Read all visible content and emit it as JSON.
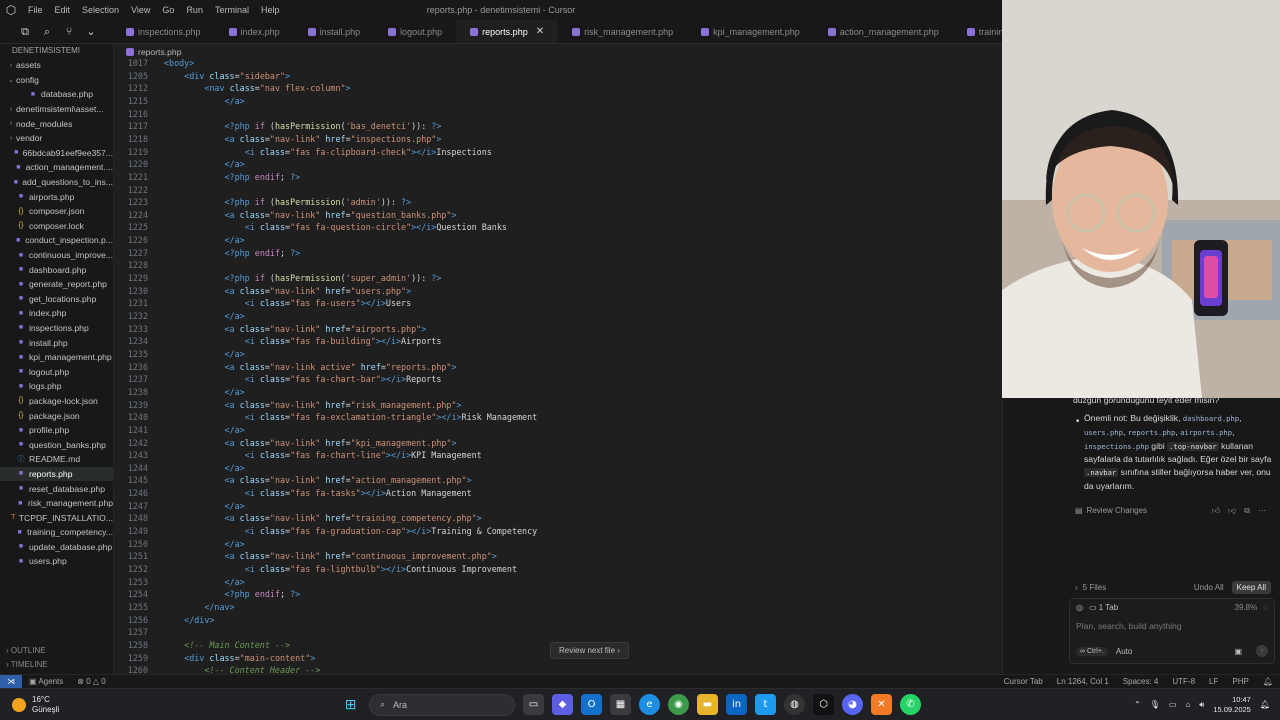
{
  "window": {
    "title": "reports.php - denetimsistemi - Cursor",
    "menu": [
      "File",
      "Edit",
      "Selection",
      "View",
      "Go",
      "Run",
      "Terminal",
      "Help"
    ]
  },
  "tabs": [
    {
      "label": "inspections.php",
      "active": false
    },
    {
      "label": "index.php",
      "active": false
    },
    {
      "label": "install.php",
      "active": false
    },
    {
      "label": "logout.php",
      "active": false
    },
    {
      "label": "reports.php",
      "active": true
    },
    {
      "label": "risk_management.php",
      "active": false
    },
    {
      "label": "kpi_management.php",
      "active": false
    },
    {
      "label": "action_management.php",
      "active": false
    },
    {
      "label": "training_compe",
      "active": false
    }
  ],
  "explorer": {
    "root": "DENETIMSISTEMI",
    "items": [
      {
        "label": "assets",
        "type": "folder",
        "indent": 1
      },
      {
        "label": "config",
        "type": "folder-open",
        "indent": 1
      },
      {
        "label": "database.php",
        "type": "php",
        "indent": 2
      },
      {
        "label": "denetimsistemi\\asset...",
        "type": "folder",
        "indent": 1
      },
      {
        "label": "node_modules",
        "type": "folder",
        "indent": 1
      },
      {
        "label": "vendor",
        "type": "folder",
        "indent": 1
      },
      {
        "label": "66bdcab91eef9ee357...",
        "type": "php",
        "indent": 1
      },
      {
        "label": "action_management....",
        "type": "php",
        "indent": 1
      },
      {
        "label": "add_questions_to_ins...",
        "type": "php",
        "indent": 1
      },
      {
        "label": "airports.php",
        "type": "php",
        "indent": 1
      },
      {
        "label": "composer.json",
        "type": "json",
        "indent": 1
      },
      {
        "label": "composer.lock",
        "type": "json",
        "indent": 1
      },
      {
        "label": "conduct_inspection.p...",
        "type": "php",
        "indent": 1
      },
      {
        "label": "continuous_improve...",
        "type": "php",
        "indent": 1
      },
      {
        "label": "dashboard.php",
        "type": "php",
        "indent": 1
      },
      {
        "label": "generate_report.php",
        "type": "php",
        "indent": 1
      },
      {
        "label": "get_locations.php",
        "type": "php",
        "indent": 1
      },
      {
        "label": "index.php",
        "type": "php",
        "indent": 1
      },
      {
        "label": "inspections.php",
        "type": "php",
        "indent": 1
      },
      {
        "label": "install.php",
        "type": "php",
        "indent": 1
      },
      {
        "label": "kpi_management.php",
        "type": "php",
        "indent": 1
      },
      {
        "label": "logout.php",
        "type": "php",
        "indent": 1
      },
      {
        "label": "logs.php",
        "type": "php",
        "indent": 1
      },
      {
        "label": "package-lock.json",
        "type": "json",
        "indent": 1
      },
      {
        "label": "package.json",
        "type": "json",
        "indent": 1
      },
      {
        "label": "profile.php",
        "type": "php",
        "indent": 1
      },
      {
        "label": "question_banks.php",
        "type": "php",
        "indent": 1
      },
      {
        "label": "README.md",
        "type": "md",
        "indent": 1
      },
      {
        "label": "reports.php",
        "type": "php",
        "indent": 1,
        "selected": true
      },
      {
        "label": "reset_database.php",
        "type": "php",
        "indent": 1
      },
      {
        "label": "risk_management.php",
        "type": "php",
        "indent": 1
      },
      {
        "label": "TCPDF_INSTALLATIO...",
        "type": "tex",
        "indent": 1
      },
      {
        "label": "training_competency...",
        "type": "php",
        "indent": 1
      },
      {
        "label": "update_database.php",
        "type": "php",
        "indent": 1
      },
      {
        "label": "users.php",
        "type": "php",
        "indent": 1
      }
    ],
    "outline": "OUTLINE",
    "timeline": "TIMELINE"
  },
  "editor": {
    "breadcrumb": "reports.php",
    "review_next": "Review next file",
    "lines": [
      {
        "n": "1017",
        "html": "<span class=\"tok-tag\">&lt;body&gt;</span>"
      },
      {
        "n": "1205",
        "html": "    <span class=\"tok-tag\">&lt;div</span> <span class=\"tok-attr\">class</span>=<span class=\"tok-str\">\"sidebar\"</span><span class=\"tok-tag\">&gt;</span>"
      },
      {
        "n": "1212",
        "html": "        <span class=\"tok-tag\">&lt;nav</span> <span class=\"tok-attr\">class</span>=<span class=\"tok-str\">\"nav flex-column\"</span><span class=\"tok-tag\">&gt;</span>"
      },
      {
        "n": "1215",
        "html": "            <span class=\"tok-tag\">&lt;/a&gt;</span>"
      },
      {
        "n": "1216",
        "html": ""
      },
      {
        "n": "1217",
        "html": "            <span class=\"tok-php\">&lt;?php</span> <span class=\"tok-kw\">if</span> (<span class=\"tok-fn\">hasPermission</span>(<span class=\"tok-str\">'bas_denetci'</span>)): <span class=\"tok-php\">?&gt;</span>"
      },
      {
        "n": "1218",
        "html": "            <span class=\"tok-tag\">&lt;a</span> <span class=\"tok-attr\">class</span>=<span class=\"tok-str\">\"nav-link\"</span> <span class=\"tok-attr\">href</span>=<span class=\"tok-str\">\"inspections.php\"</span><span class=\"tok-tag\">&gt;</span>"
      },
      {
        "n": "1219",
        "html": "                <span class=\"tok-tag\">&lt;i</span> <span class=\"tok-attr\">class</span>=<span class=\"tok-str\">\"fas fa-clipboard-check\"</span><span class=\"tok-tag\">&gt;&lt;/i&gt;</span>Inspections"
      },
      {
        "n": "1220",
        "html": "            <span class=\"tok-tag\">&lt;/a&gt;</span>"
      },
      {
        "n": "1221",
        "html": "            <span class=\"tok-php\">&lt;?php</span> <span class=\"tok-kw\">endif</span>; <span class=\"tok-php\">?&gt;</span>"
      },
      {
        "n": "1222",
        "html": ""
      },
      {
        "n": "1223",
        "html": "            <span class=\"tok-php\">&lt;?php</span> <span class=\"tok-kw\">if</span> (<span class=\"tok-fn\">hasPermission</span>(<span class=\"tok-str\">'admin'</span>)): <span class=\"tok-php\">?&gt;</span>"
      },
      {
        "n": "1224",
        "html": "            <span class=\"tok-tag\">&lt;a</span> <span class=\"tok-attr\">class</span>=<span class=\"tok-str\">\"nav-link\"</span> <span class=\"tok-attr\">href</span>=<span class=\"tok-str\">\"question_banks.php\"</span><span class=\"tok-tag\">&gt;</span>"
      },
      {
        "n": "1225",
        "html": "                <span class=\"tok-tag\">&lt;i</span> <span class=\"tok-attr\">class</span>=<span class=\"tok-str\">\"fas fa-question-circle\"</span><span class=\"tok-tag\">&gt;&lt;/i&gt;</span>Question Banks"
      },
      {
        "n": "1226",
        "html": "            <span class=\"tok-tag\">&lt;/a&gt;</span>"
      },
      {
        "n": "1227",
        "html": "            <span class=\"tok-php\">&lt;?php</span> <span class=\"tok-kw\">endif</span>; <span class=\"tok-php\">?&gt;</span>"
      },
      {
        "n": "1228",
        "html": ""
      },
      {
        "n": "1229",
        "html": "            <span class=\"tok-php\">&lt;?php</span> <span class=\"tok-kw\">if</span> (<span class=\"tok-fn\">hasPermission</span>(<span class=\"tok-str\">'super_admin'</span>)): <span class=\"tok-php\">?&gt;</span>"
      },
      {
        "n": "1230",
        "html": "            <span class=\"tok-tag\">&lt;a</span> <span class=\"tok-attr\">class</span>=<span class=\"tok-str\">\"nav-link\"</span> <span class=\"tok-attr\">href</span>=<span class=\"tok-str\">\"users.php\"</span><span class=\"tok-tag\">&gt;</span>"
      },
      {
        "n": "1231",
        "html": "                <span class=\"tok-tag\">&lt;i</span> <span class=\"tok-attr\">class</span>=<span class=\"tok-str\">\"fas fa-users\"</span><span class=\"tok-tag\">&gt;&lt;/i&gt;</span>Users"
      },
      {
        "n": "1232",
        "html": "            <span class=\"tok-tag\">&lt;/a&gt;</span>"
      },
      {
        "n": "1233",
        "html": "            <span class=\"tok-tag\">&lt;a</span> <span class=\"tok-attr\">class</span>=<span class=\"tok-str\">\"nav-link\"</span> <span class=\"tok-attr\">href</span>=<span class=\"tok-str\">\"airports.php\"</span><span class=\"tok-tag\">&gt;</span>"
      },
      {
        "n": "1234",
        "html": "                <span class=\"tok-tag\">&lt;i</span> <span class=\"tok-attr\">class</span>=<span class=\"tok-str\">\"fas fa-building\"</span><span class=\"tok-tag\">&gt;&lt;/i&gt;</span>Airports"
      },
      {
        "n": "1235",
        "html": "            <span class=\"tok-tag\">&lt;/a&gt;</span>"
      },
      {
        "n": "1236",
        "html": "            <span class=\"tok-tag\">&lt;a</span> <span class=\"tok-attr\">class</span>=<span class=\"tok-str\">\"nav-link active\"</span> <span class=\"tok-attr\">href</span>=<span class=\"tok-str\">\"reports.php\"</span><span class=\"tok-tag\">&gt;</span>"
      },
      {
        "n": "1237",
        "html": "                <span class=\"tok-tag\">&lt;i</span> <span class=\"tok-attr\">class</span>=<span class=\"tok-str\">\"fas fa-chart-bar\"</span><span class=\"tok-tag\">&gt;&lt;/i&gt;</span>Reports"
      },
      {
        "n": "1238",
        "html": "            <span class=\"tok-tag\">&lt;/a&gt;</span>"
      },
      {
        "n": "1239",
        "html": "            <span class=\"tok-tag\">&lt;a</span> <span class=\"tok-attr\">class</span>=<span class=\"tok-str\">\"nav-link\"</span> <span class=\"tok-attr\">href</span>=<span class=\"tok-str\">\"risk_management.php\"</span><span class=\"tok-tag\">&gt;</span>"
      },
      {
        "n": "1240",
        "html": "                <span class=\"tok-tag\">&lt;i</span> <span class=\"tok-attr\">class</span>=<span class=\"tok-str\">\"fas fa-exclamation-triangle\"</span><span class=\"tok-tag\">&gt;&lt;/i&gt;</span>Risk Management"
      },
      {
        "n": "1241",
        "html": "            <span class=\"tok-tag\">&lt;/a&gt;</span>"
      },
      {
        "n": "1242",
        "html": "            <span class=\"tok-tag\">&lt;a</span> <span class=\"tok-attr\">class</span>=<span class=\"tok-str\">\"nav-link\"</span> <span class=\"tok-attr\">href</span>=<span class=\"tok-str\">\"kpi_management.php\"</span><span class=\"tok-tag\">&gt;</span>"
      },
      {
        "n": "1243",
        "html": "                <span class=\"tok-tag\">&lt;i</span> <span class=\"tok-attr\">class</span>=<span class=\"tok-str\">\"fas fa-chart-line\"</span><span class=\"tok-tag\">&gt;&lt;/i&gt;</span>KPI Management"
      },
      {
        "n": "1244",
        "html": "            <span class=\"tok-tag\">&lt;/a&gt;</span>"
      },
      {
        "n": "1245",
        "html": "            <span class=\"tok-tag\">&lt;a</span> <span class=\"tok-attr\">class</span>=<span class=\"tok-str\">\"nav-link\"</span> <span class=\"tok-attr\">href</span>=<span class=\"tok-str\">\"action_management.php\"</span><span class=\"tok-tag\">&gt;</span>"
      },
      {
        "n": "1246",
        "html": "                <span class=\"tok-tag\">&lt;i</span> <span class=\"tok-attr\">class</span>=<span class=\"tok-str\">\"fas fa-tasks\"</span><span class=\"tok-tag\">&gt;&lt;/i&gt;</span>Action Management"
      },
      {
        "n": "1247",
        "html": "            <span class=\"tok-tag\">&lt;/a&gt;</span>"
      },
      {
        "n": "1248",
        "html": "            <span class=\"tok-tag\">&lt;a</span> <span class=\"tok-attr\">class</span>=<span class=\"tok-str\">\"nav-link\"</span> <span class=\"tok-attr\">href</span>=<span class=\"tok-str\">\"training_competency.php\"</span><span class=\"tok-tag\">&gt;</span>"
      },
      {
        "n": "1249",
        "html": "                <span class=\"tok-tag\">&lt;i</span> <span class=\"tok-attr\">class</span>=<span class=\"tok-str\">\"fas fa-graduation-cap\"</span><span class=\"tok-tag\">&gt;&lt;/i&gt;</span>Training &amp; Competency"
      },
      {
        "n": "1250",
        "html": "            <span class=\"tok-tag\">&lt;/a&gt;</span>"
      },
      {
        "n": "1251",
        "html": "            <span class=\"tok-tag\">&lt;a</span> <span class=\"tok-attr\">class</span>=<span class=\"tok-str\">\"nav-link\"</span> <span class=\"tok-attr\">href</span>=<span class=\"tok-str\">\"continuous_improvement.php\"</span><span class=\"tok-tag\">&gt;</span>"
      },
      {
        "n": "1252",
        "html": "                <span class=\"tok-tag\">&lt;i</span> <span class=\"tok-attr\">class</span>=<span class=\"tok-str\">\"fas fa-lightbulb\"</span><span class=\"tok-tag\">&gt;&lt;/i&gt;</span>Continuous Improvement"
      },
      {
        "n": "1253",
        "html": "            <span class=\"tok-tag\">&lt;/a&gt;</span>"
      },
      {
        "n": "1254",
        "html": "            <span class=\"tok-php\">&lt;?php</span> <span class=\"tok-kw\">endif</span>; <span class=\"tok-php\">?&gt;</span>"
      },
      {
        "n": "1255",
        "html": "        <span class=\"tok-tag\">&lt;/nav&gt;</span>"
      },
      {
        "n": "1256",
        "html": "    <span class=\"tok-tag\">&lt;/div&gt;</span>"
      },
      {
        "n": "1257",
        "html": ""
      },
      {
        "n": "1258",
        "html": "    <span class=\"tok-cm\">&lt;!-- Main Content --&gt;</span>"
      },
      {
        "n": "1259",
        "html": "    <span class=\"tok-tag\">&lt;div</span> <span class=\"tok-attr\">class</span>=<span class=\"tok-str\">\"main-content\"</span><span class=\"tok-tag\">&gt;</span>"
      },
      {
        "n": "1260",
        "html": "        <span class=\"tok-cm\">&lt;!-- Content Header --&gt;</span>"
      }
    ]
  },
  "chat": {
    "partial_line": "düzgün göründüğünü teyit eder misin?",
    "note_html": "Önemli not: Bu değişiklik, <span class=\"code-chip\">dashboard.php</span>, <span class=\"code-chip\">users.php</span>, <span class=\"code-chip\">reports.php</span>, <span class=\"code-chip\">airports.php</span>, <span class=\"code-chip\">inspections.php</span> gibi <span class=\"code-chip bg\">.top-navbar</span> kullanan sayfalarla da tutarlılık sağladı. Eğer özel bir sayfa <span class=\"code-chip bg\">.navbar</span> sınıfına stiller bağlıyorsa haber ver, onu da uyarlarım.",
    "review_changes": "Review Changes",
    "files_count": "5 Files",
    "undo_all": "Undo All",
    "keep_all": "Keep All",
    "input_tab": "1 Tab",
    "context_pct": "39.8%",
    "placeholder": "Plan, search, build anything",
    "mode_chip": "Ctrl+.",
    "mode": "Auto"
  },
  "statusbar": {
    "agents": "Agents",
    "problems": "0",
    "warnings": "0",
    "tab_label": "Cursor Tab",
    "position": "Ln 1264, Col 1",
    "spaces": "Spaces: 4",
    "encoding": "UTF-8",
    "eol": "LF",
    "language": "PHP"
  },
  "taskbar": {
    "temperature": "16°C",
    "weather": "Güneşli",
    "search_placeholder": "Ara",
    "time": "10:47",
    "date": "15.09.2025"
  }
}
